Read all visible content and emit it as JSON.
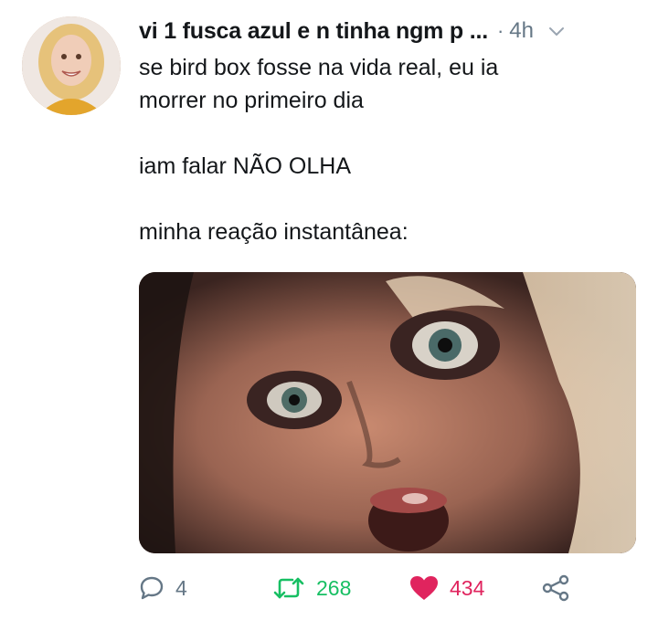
{
  "tweet": {
    "display_name": "vi 1 fusca azul e n tinha ngm p ...",
    "separator": "·",
    "timestamp": "4h",
    "lines": [
      "se bird box fosse na vida real, eu ia",
      "morrer no primeiro dia",
      "iam falar NÃO OLHA",
      "minha reação instantânea:"
    ]
  },
  "actions": {
    "reply_count": "4",
    "retweet_count": "268",
    "like_count": "434"
  },
  "colors": {
    "retweet": "#17bf63",
    "like": "#e0245e",
    "muted": "#657786"
  },
  "icons": {
    "reply": "reply-icon",
    "retweet": "retweet-icon",
    "like": "heart-icon",
    "share": "share-icon",
    "menu": "chevron-down-icon"
  }
}
